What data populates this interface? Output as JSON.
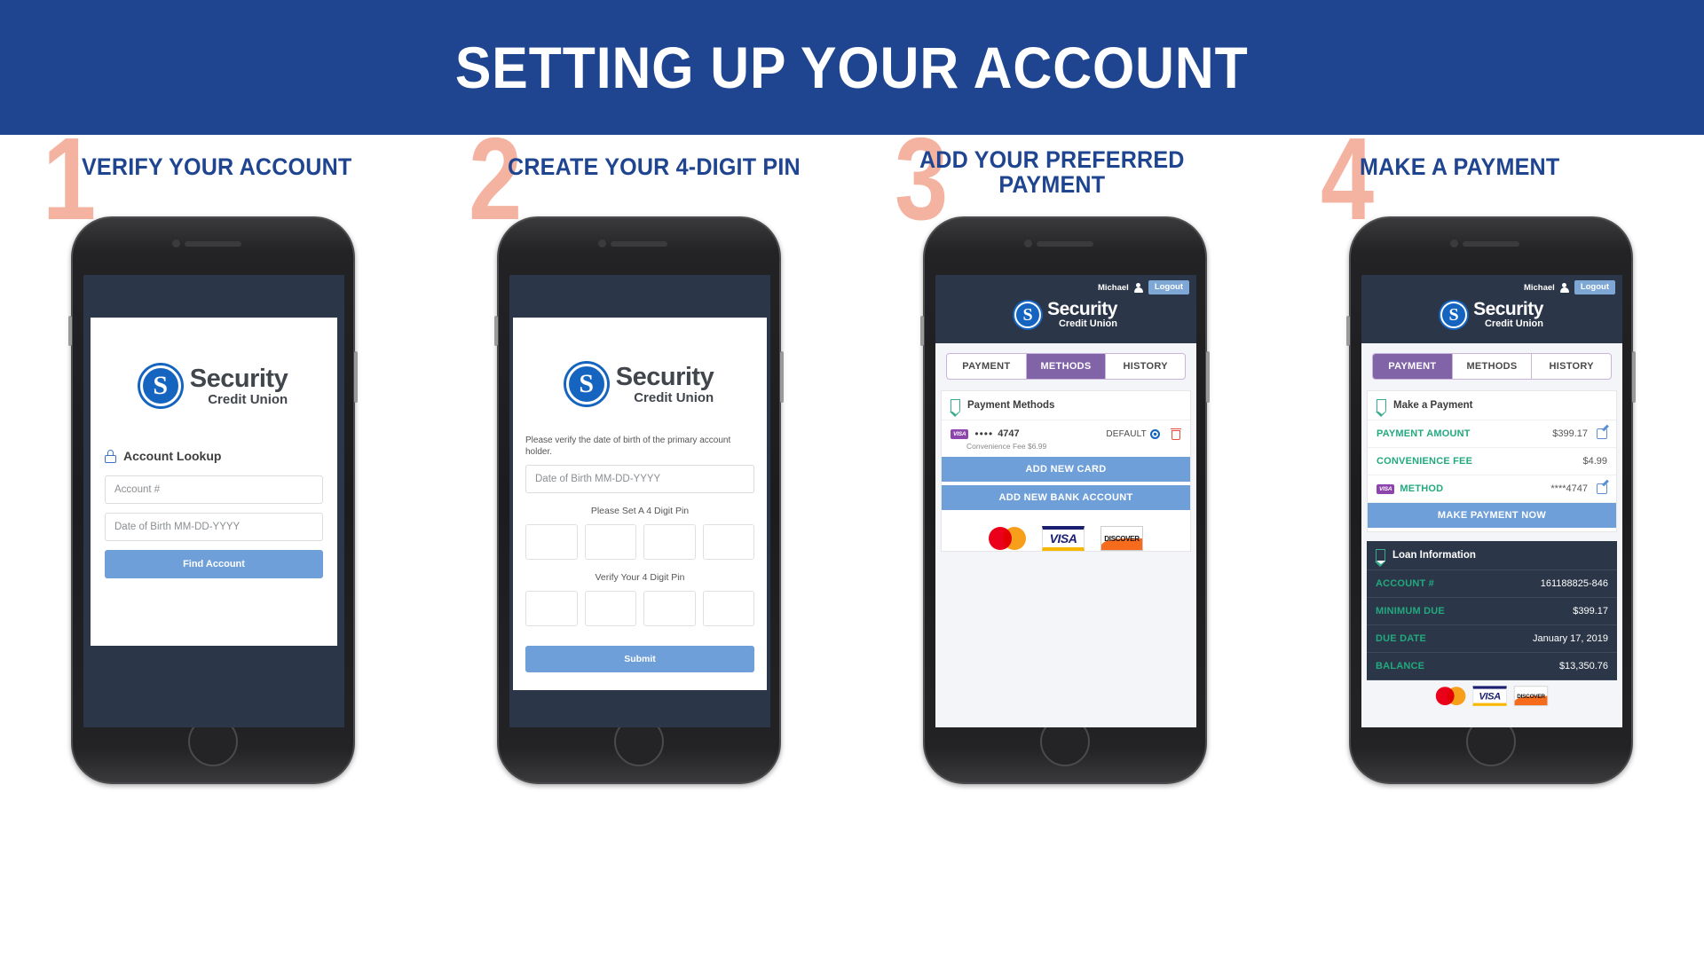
{
  "banner": {
    "title": "SETTING UP YOUR ACCOUNT"
  },
  "brand": {
    "logo_letter": "S",
    "name_line1": "Security",
    "name_line2": "Credit Union",
    "blue": "#1565c0",
    "header_blue": "#1f4590",
    "step_number_color": "#f4b3a0",
    "accent_purple": "#8163a8",
    "accent_green": "#22a97f",
    "button_blue": "#6f9fd8"
  },
  "steps": [
    {
      "number": "1",
      "title": "VERIFY YOUR ACCOUNT"
    },
    {
      "number": "2",
      "title": "CREATE YOUR 4-DIGIT PIN"
    },
    {
      "number": "3",
      "title": "ADD YOUR PREFERRED PAYMENT"
    },
    {
      "number": "4",
      "title": "MAKE A PAYMENT"
    }
  ],
  "screen1": {
    "section_title": "Account Lookup",
    "lock_icon": "lock-icon",
    "fields": [
      {
        "placeholder": "Account #"
      },
      {
        "placeholder": "Date of Birth MM-DD-YYYY"
      }
    ],
    "submit_label": "Find Account"
  },
  "screen2": {
    "verify_note": "Please verify the date of birth of the primary account holder.",
    "dob_placeholder": "Date of Birth MM-DD-YYYY",
    "set_pin_label": "Please Set A 4 Digit Pin",
    "verify_pin_label": "Verify Your 4 Digit Pin",
    "pin_boxes": [
      "",
      "",
      "",
      ""
    ],
    "submit_label": "Submit"
  },
  "screen3": {
    "user_name": "Michael",
    "user_icon": "person-icon",
    "logout_label": "Logout",
    "tabs": [
      {
        "label": "PAYMENT",
        "active": false
      },
      {
        "label": "METHODS",
        "active": true
      },
      {
        "label": "HISTORY",
        "active": false
      }
    ],
    "panel_title": "Payment Methods",
    "panel_icon": "bookmark-icon",
    "method": {
      "brand": "VISA",
      "dots": "••••",
      "last4": "4747",
      "default_label": "DEFAULT",
      "default_selected": true,
      "delete_icon": "trash-icon",
      "fee_note": "Convenience Fee $6.99"
    },
    "add_card_label": "ADD NEW CARD",
    "add_bank_label": "ADD NEW BANK ACCOUNT",
    "card_logos": [
      "mastercard-logo",
      "visa-logo",
      "discover-logo"
    ],
    "visa_logo_text": "VISA",
    "discover_logo_text": "DISCOVER"
  },
  "screen4": {
    "user_name": "Michael",
    "user_icon": "person-icon",
    "logout_label": "Logout",
    "tabs": [
      {
        "label": "PAYMENT",
        "active": true
      },
      {
        "label": "METHODS",
        "active": false
      },
      {
        "label": "HISTORY",
        "active": false
      }
    ],
    "panel_title": "Make a Payment",
    "panel_icon": "bookmark-icon",
    "payment_rows": [
      {
        "label": "PAYMENT AMOUNT",
        "value": "$399.17",
        "editable": true
      },
      {
        "label": "CONVENIENCE FEE",
        "value": "$4.99",
        "editable": false
      },
      {
        "label": "METHOD",
        "value": "****4747",
        "editable": true,
        "brand": "VISA"
      }
    ],
    "make_payment_label": "MAKE PAYMENT NOW",
    "loan_title": "Loan Information",
    "loan_icon": "bookmark-icon",
    "loan_rows": [
      {
        "label": "ACCOUNT #",
        "value": "161188825-846"
      },
      {
        "label": "MINIMUM DUE",
        "value": "$399.17"
      },
      {
        "label": "DUE DATE",
        "value": "January 17, 2019"
      },
      {
        "label": "BALANCE",
        "value": "$13,350.76"
      }
    ],
    "visa_logo_text": "VISA",
    "discover_logo_text": "DISCOVER"
  }
}
